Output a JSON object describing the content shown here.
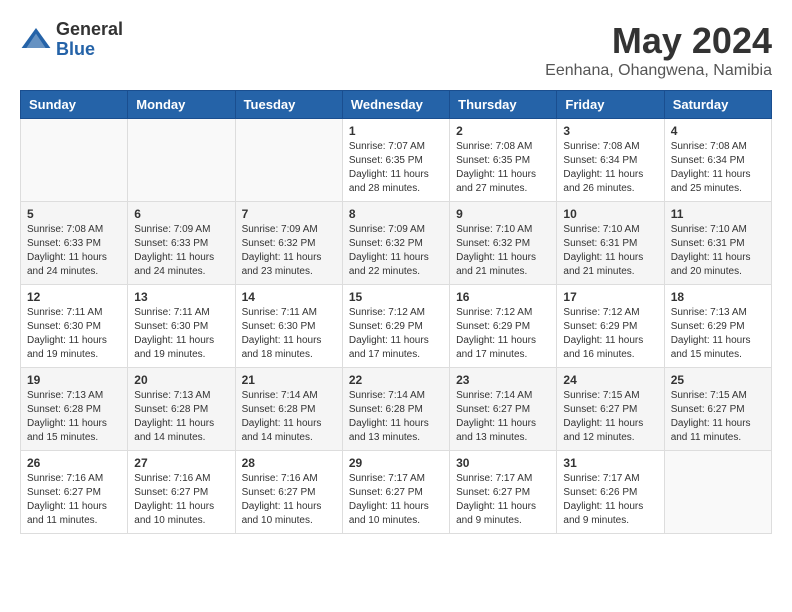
{
  "header": {
    "logo_general": "General",
    "logo_blue": "Blue",
    "month_title": "May 2024",
    "subtitle": "Eenhana, Ohangwena, Namibia"
  },
  "weekdays": [
    "Sunday",
    "Monday",
    "Tuesday",
    "Wednesday",
    "Thursday",
    "Friday",
    "Saturday"
  ],
  "weeks": [
    [
      {
        "day": "",
        "info": ""
      },
      {
        "day": "",
        "info": ""
      },
      {
        "day": "",
        "info": ""
      },
      {
        "day": "1",
        "info": "Sunrise: 7:07 AM\nSunset: 6:35 PM\nDaylight: 11 hours\nand 28 minutes."
      },
      {
        "day": "2",
        "info": "Sunrise: 7:08 AM\nSunset: 6:35 PM\nDaylight: 11 hours\nand 27 minutes."
      },
      {
        "day": "3",
        "info": "Sunrise: 7:08 AM\nSunset: 6:34 PM\nDaylight: 11 hours\nand 26 minutes."
      },
      {
        "day": "4",
        "info": "Sunrise: 7:08 AM\nSunset: 6:34 PM\nDaylight: 11 hours\nand 25 minutes."
      }
    ],
    [
      {
        "day": "5",
        "info": "Sunrise: 7:08 AM\nSunset: 6:33 PM\nDaylight: 11 hours\nand 24 minutes."
      },
      {
        "day": "6",
        "info": "Sunrise: 7:09 AM\nSunset: 6:33 PM\nDaylight: 11 hours\nand 24 minutes."
      },
      {
        "day": "7",
        "info": "Sunrise: 7:09 AM\nSunset: 6:32 PM\nDaylight: 11 hours\nand 23 minutes."
      },
      {
        "day": "8",
        "info": "Sunrise: 7:09 AM\nSunset: 6:32 PM\nDaylight: 11 hours\nand 22 minutes."
      },
      {
        "day": "9",
        "info": "Sunrise: 7:10 AM\nSunset: 6:32 PM\nDaylight: 11 hours\nand 21 minutes."
      },
      {
        "day": "10",
        "info": "Sunrise: 7:10 AM\nSunset: 6:31 PM\nDaylight: 11 hours\nand 21 minutes."
      },
      {
        "day": "11",
        "info": "Sunrise: 7:10 AM\nSunset: 6:31 PM\nDaylight: 11 hours\nand 20 minutes."
      }
    ],
    [
      {
        "day": "12",
        "info": "Sunrise: 7:11 AM\nSunset: 6:30 PM\nDaylight: 11 hours\nand 19 minutes."
      },
      {
        "day": "13",
        "info": "Sunrise: 7:11 AM\nSunset: 6:30 PM\nDaylight: 11 hours\nand 19 minutes."
      },
      {
        "day": "14",
        "info": "Sunrise: 7:11 AM\nSunset: 6:30 PM\nDaylight: 11 hours\nand 18 minutes."
      },
      {
        "day": "15",
        "info": "Sunrise: 7:12 AM\nSunset: 6:29 PM\nDaylight: 11 hours\nand 17 minutes."
      },
      {
        "day": "16",
        "info": "Sunrise: 7:12 AM\nSunset: 6:29 PM\nDaylight: 11 hours\nand 17 minutes."
      },
      {
        "day": "17",
        "info": "Sunrise: 7:12 AM\nSunset: 6:29 PM\nDaylight: 11 hours\nand 16 minutes."
      },
      {
        "day": "18",
        "info": "Sunrise: 7:13 AM\nSunset: 6:29 PM\nDaylight: 11 hours\nand 15 minutes."
      }
    ],
    [
      {
        "day": "19",
        "info": "Sunrise: 7:13 AM\nSunset: 6:28 PM\nDaylight: 11 hours\nand 15 minutes."
      },
      {
        "day": "20",
        "info": "Sunrise: 7:13 AM\nSunset: 6:28 PM\nDaylight: 11 hours\nand 14 minutes."
      },
      {
        "day": "21",
        "info": "Sunrise: 7:14 AM\nSunset: 6:28 PM\nDaylight: 11 hours\nand 14 minutes."
      },
      {
        "day": "22",
        "info": "Sunrise: 7:14 AM\nSunset: 6:28 PM\nDaylight: 11 hours\nand 13 minutes."
      },
      {
        "day": "23",
        "info": "Sunrise: 7:14 AM\nSunset: 6:27 PM\nDaylight: 11 hours\nand 13 minutes."
      },
      {
        "day": "24",
        "info": "Sunrise: 7:15 AM\nSunset: 6:27 PM\nDaylight: 11 hours\nand 12 minutes."
      },
      {
        "day": "25",
        "info": "Sunrise: 7:15 AM\nSunset: 6:27 PM\nDaylight: 11 hours\nand 11 minutes."
      }
    ],
    [
      {
        "day": "26",
        "info": "Sunrise: 7:16 AM\nSunset: 6:27 PM\nDaylight: 11 hours\nand 11 minutes."
      },
      {
        "day": "27",
        "info": "Sunrise: 7:16 AM\nSunset: 6:27 PM\nDaylight: 11 hours\nand 10 minutes."
      },
      {
        "day": "28",
        "info": "Sunrise: 7:16 AM\nSunset: 6:27 PM\nDaylight: 11 hours\nand 10 minutes."
      },
      {
        "day": "29",
        "info": "Sunrise: 7:17 AM\nSunset: 6:27 PM\nDaylight: 11 hours\nand 10 minutes."
      },
      {
        "day": "30",
        "info": "Sunrise: 7:17 AM\nSunset: 6:27 PM\nDaylight: 11 hours\nand 9 minutes."
      },
      {
        "day": "31",
        "info": "Sunrise: 7:17 AM\nSunset: 6:26 PM\nDaylight: 11 hours\nand 9 minutes."
      },
      {
        "day": "",
        "info": ""
      }
    ]
  ]
}
